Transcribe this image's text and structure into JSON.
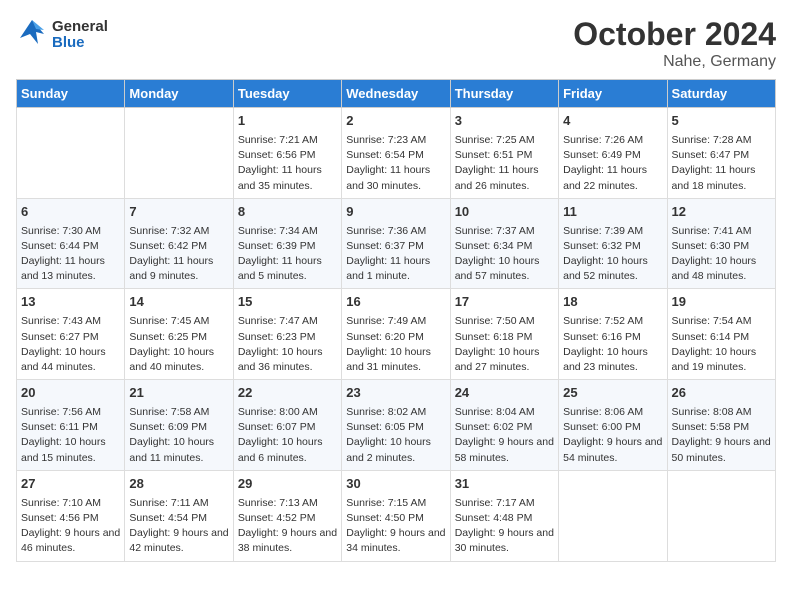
{
  "header": {
    "logo_general": "General",
    "logo_blue": "Blue",
    "month": "October 2024",
    "location": "Nahe, Germany"
  },
  "weekdays": [
    "Sunday",
    "Monday",
    "Tuesday",
    "Wednesday",
    "Thursday",
    "Friday",
    "Saturday"
  ],
  "weeks": [
    [
      {
        "day": "",
        "info": ""
      },
      {
        "day": "",
        "info": ""
      },
      {
        "day": "1",
        "info": "Sunrise: 7:21 AM\nSunset: 6:56 PM\nDaylight: 11 hours and 35 minutes."
      },
      {
        "day": "2",
        "info": "Sunrise: 7:23 AM\nSunset: 6:54 PM\nDaylight: 11 hours and 30 minutes."
      },
      {
        "day": "3",
        "info": "Sunrise: 7:25 AM\nSunset: 6:51 PM\nDaylight: 11 hours and 26 minutes."
      },
      {
        "day": "4",
        "info": "Sunrise: 7:26 AM\nSunset: 6:49 PM\nDaylight: 11 hours and 22 minutes."
      },
      {
        "day": "5",
        "info": "Sunrise: 7:28 AM\nSunset: 6:47 PM\nDaylight: 11 hours and 18 minutes."
      }
    ],
    [
      {
        "day": "6",
        "info": "Sunrise: 7:30 AM\nSunset: 6:44 PM\nDaylight: 11 hours and 13 minutes."
      },
      {
        "day": "7",
        "info": "Sunrise: 7:32 AM\nSunset: 6:42 PM\nDaylight: 11 hours and 9 minutes."
      },
      {
        "day": "8",
        "info": "Sunrise: 7:34 AM\nSunset: 6:39 PM\nDaylight: 11 hours and 5 minutes."
      },
      {
        "day": "9",
        "info": "Sunrise: 7:36 AM\nSunset: 6:37 PM\nDaylight: 11 hours and 1 minute."
      },
      {
        "day": "10",
        "info": "Sunrise: 7:37 AM\nSunset: 6:34 PM\nDaylight: 10 hours and 57 minutes."
      },
      {
        "day": "11",
        "info": "Sunrise: 7:39 AM\nSunset: 6:32 PM\nDaylight: 10 hours and 52 minutes."
      },
      {
        "day": "12",
        "info": "Sunrise: 7:41 AM\nSunset: 6:30 PM\nDaylight: 10 hours and 48 minutes."
      }
    ],
    [
      {
        "day": "13",
        "info": "Sunrise: 7:43 AM\nSunset: 6:27 PM\nDaylight: 10 hours and 44 minutes."
      },
      {
        "day": "14",
        "info": "Sunrise: 7:45 AM\nSunset: 6:25 PM\nDaylight: 10 hours and 40 minutes."
      },
      {
        "day": "15",
        "info": "Sunrise: 7:47 AM\nSunset: 6:23 PM\nDaylight: 10 hours and 36 minutes."
      },
      {
        "day": "16",
        "info": "Sunrise: 7:49 AM\nSunset: 6:20 PM\nDaylight: 10 hours and 31 minutes."
      },
      {
        "day": "17",
        "info": "Sunrise: 7:50 AM\nSunset: 6:18 PM\nDaylight: 10 hours and 27 minutes."
      },
      {
        "day": "18",
        "info": "Sunrise: 7:52 AM\nSunset: 6:16 PM\nDaylight: 10 hours and 23 minutes."
      },
      {
        "day": "19",
        "info": "Sunrise: 7:54 AM\nSunset: 6:14 PM\nDaylight: 10 hours and 19 minutes."
      }
    ],
    [
      {
        "day": "20",
        "info": "Sunrise: 7:56 AM\nSunset: 6:11 PM\nDaylight: 10 hours and 15 minutes."
      },
      {
        "day": "21",
        "info": "Sunrise: 7:58 AM\nSunset: 6:09 PM\nDaylight: 10 hours and 11 minutes."
      },
      {
        "day": "22",
        "info": "Sunrise: 8:00 AM\nSunset: 6:07 PM\nDaylight: 10 hours and 6 minutes."
      },
      {
        "day": "23",
        "info": "Sunrise: 8:02 AM\nSunset: 6:05 PM\nDaylight: 10 hours and 2 minutes."
      },
      {
        "day": "24",
        "info": "Sunrise: 8:04 AM\nSunset: 6:02 PM\nDaylight: 9 hours and 58 minutes."
      },
      {
        "day": "25",
        "info": "Sunrise: 8:06 AM\nSunset: 6:00 PM\nDaylight: 9 hours and 54 minutes."
      },
      {
        "day": "26",
        "info": "Sunrise: 8:08 AM\nSunset: 5:58 PM\nDaylight: 9 hours and 50 minutes."
      }
    ],
    [
      {
        "day": "27",
        "info": "Sunrise: 7:10 AM\nSunset: 4:56 PM\nDaylight: 9 hours and 46 minutes."
      },
      {
        "day": "28",
        "info": "Sunrise: 7:11 AM\nSunset: 4:54 PM\nDaylight: 9 hours and 42 minutes."
      },
      {
        "day": "29",
        "info": "Sunrise: 7:13 AM\nSunset: 4:52 PM\nDaylight: 9 hours and 38 minutes."
      },
      {
        "day": "30",
        "info": "Sunrise: 7:15 AM\nSunset: 4:50 PM\nDaylight: 9 hours and 34 minutes."
      },
      {
        "day": "31",
        "info": "Sunrise: 7:17 AM\nSunset: 4:48 PM\nDaylight: 9 hours and 30 minutes."
      },
      {
        "day": "",
        "info": ""
      },
      {
        "day": "",
        "info": ""
      }
    ]
  ]
}
